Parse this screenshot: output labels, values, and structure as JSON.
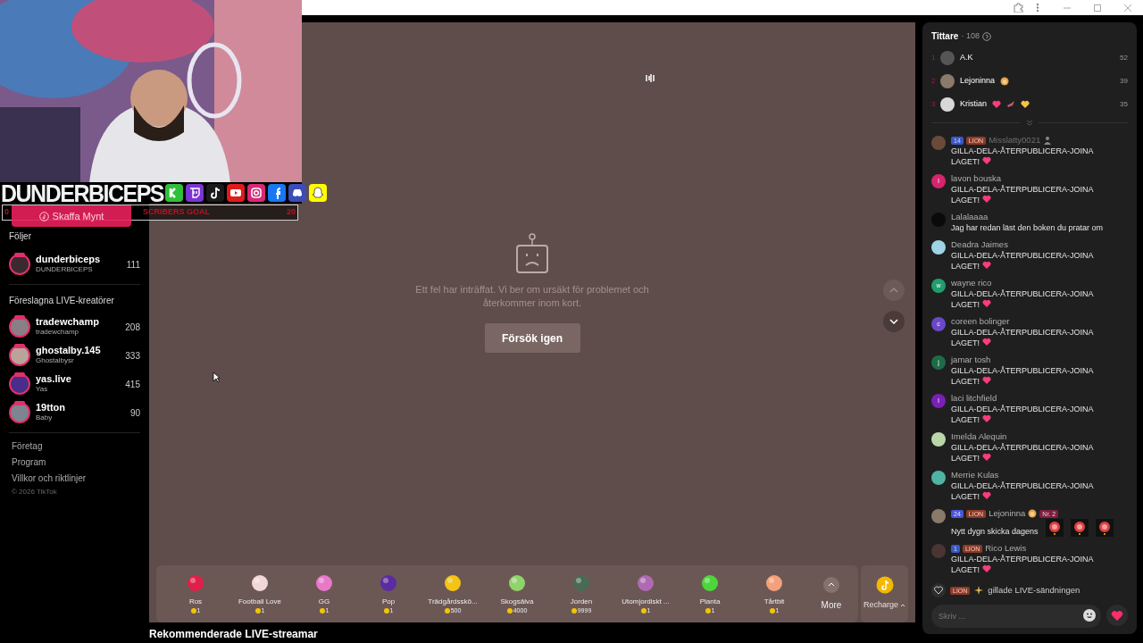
{
  "overlay": {
    "channel_name": "DUNDERBICEPS",
    "socials": [
      {
        "kind": "kick",
        "color": "#2fbf3a"
      },
      {
        "kind": "twitch",
        "color": "#7a34d1"
      },
      {
        "kind": "tiktok",
        "color": "#1a1a1a"
      },
      {
        "kind": "youtube",
        "color": "#e01b1b"
      },
      {
        "kind": "instagram",
        "color": "#d62976"
      },
      {
        "kind": "facebook",
        "color": "#1877f2"
      },
      {
        "kind": "discord",
        "color": "#3b4bb8"
      },
      {
        "kind": "snapchat",
        "color": "#fffc00"
      }
    ],
    "goal": {
      "start": "0",
      "label": "SCRIBERS GOAL",
      "end": "20"
    }
  },
  "coins_button": "Skaffa Mynt",
  "sidebar": {
    "following_title": "Följer",
    "following": [
      {
        "name": "dunderbiceps",
        "subtitle": "DUNDERBICEPS",
        "count": "111",
        "live": true,
        "color": "#3a2a30"
      }
    ],
    "suggested_title": "Föreslagna LIVE-kreatörer",
    "suggested": [
      {
        "name": "tradewchamp",
        "subtitle": "tradewchamp",
        "count": "208",
        "live": true,
        "color": "#8a7f86"
      },
      {
        "name": "ghostalby.145",
        "subtitle": "Ghostalbysr",
        "count": "333",
        "live": true,
        "color": "#b9a49a"
      },
      {
        "name": "yas.live",
        "subtitle": "Yas",
        "count": "415",
        "live": true,
        "color": "#4a2d8a"
      },
      {
        "name": "19tton",
        "subtitle": "Baby",
        "count": "90",
        "live": true,
        "color": "#7d8590"
      }
    ],
    "links": [
      "Företag",
      "Program",
      "Villkor och riktlinjer"
    ],
    "copyright": "© 2026 TikTok"
  },
  "stream": {
    "error_text": "Ett fel har inträffat. Vi ber om ursäkt för problemet och återkommer inom kort.",
    "retry_button": "Försök igen"
  },
  "gifts": [
    {
      "name": "Ros",
      "price": "1",
      "color": "#e0204a"
    },
    {
      "name": "Football Love",
      "price": "1",
      "color": "#f2d7d7"
    },
    {
      "name": "GG",
      "price": "1",
      "color": "#e879c9"
    },
    {
      "name": "Pop",
      "price": "1",
      "color": "#5b2ca0"
    },
    {
      "name": "Trädgårdsskö...",
      "price": "500",
      "color": "#f3c316"
    },
    {
      "name": "Skogsälva",
      "price": "4000",
      "color": "#8fd46a"
    },
    {
      "name": "Jorden",
      "price": "9999",
      "color": "#4b6a55"
    },
    {
      "name": "Utomjordiskt ...",
      "price": "1",
      "color": "#b06ab3"
    },
    {
      "name": "Planta",
      "price": "1",
      "color": "#4cd63a"
    },
    {
      "name": "Tårtbit",
      "price": "1",
      "color": "#f4a07a"
    }
  ],
  "more_button": "More",
  "recharge_button": "Recharge",
  "recommended_title": "Rekommenderade LIVE-streamar",
  "chat": {
    "title": "Tittare",
    "viewer_count": "· 108",
    "top_viewers": [
      {
        "rank": "1",
        "name": "A.K",
        "score": "52",
        "color": "#555555"
      },
      {
        "rank": "2",
        "name": "Lejoninna",
        "score": "39",
        "color": "#8a7a6a",
        "icons": [
          {
            "kind": "lion"
          }
        ]
      },
      {
        "rank": "3",
        "name": "Kristian",
        "score": "35",
        "color": "#d8d8d8",
        "icons": [
          {
            "kind": "heart"
          },
          {
            "kind": "bird"
          },
          {
            "kind": "yellow-heart"
          }
        ]
      }
    ],
    "messages": [
      {
        "kind": "comment",
        "user": "Misslatty0021",
        "user_muted": true,
        "avatar": {
          "color": "#6b4a3a"
        },
        "badges": [
          {
            "kind": "level",
            "label": "14"
          },
          {
            "kind": "fan",
            "label": "LION"
          }
        ],
        "name_icons": [
          {
            "kind": "person"
          }
        ],
        "text": "GILLA-DELA-ÅTERPUBLICERA-JOINA LAGET!",
        "heart": true
      },
      {
        "kind": "comment",
        "user": "lavon bouska",
        "user_muted": false,
        "avatar": {
          "color": "#d6246e",
          "initial": "l"
        },
        "text": "GILLA-DELA-ÅTERPUBLICERA-JOINA LAGET!",
        "heart": true
      },
      {
        "kind": "comment",
        "user": "Lalalaaaa",
        "user_muted": false,
        "avatar": {
          "color": "#0a0a0a"
        },
        "text": "Jag har redan läst den boken du pratar om",
        "heart": false
      },
      {
        "kind": "comment",
        "user": "Deadra Jaimes",
        "user_muted": false,
        "avatar": {
          "color": "#9fd3e6"
        },
        "text": "GILLA-DELA-ÅTERPUBLICERA-JOINA LAGET!",
        "heart": true
      },
      {
        "kind": "comment",
        "user": "wayne rico",
        "user_muted": false,
        "avatar": {
          "color": "#1f9d6e",
          "initial": "w"
        },
        "text": "GILLA-DELA-ÅTERPUBLICERA-JOINA LAGET!",
        "heart": true
      },
      {
        "kind": "comment",
        "user": "coreen bolinger",
        "user_muted": false,
        "avatar": {
          "color": "#6a48c9",
          "initial": "c"
        },
        "text": "GILLA-DELA-ÅTERPUBLICERA-JOINA LAGET!",
        "heart": true
      },
      {
        "kind": "comment",
        "user": "jamar tosh",
        "user_muted": false,
        "avatar": {
          "color": "#1e6b47",
          "initial": "j"
        },
        "text": "GILLA-DELA-ÅTERPUBLICERA-JOINA LAGET!",
        "heart": true
      },
      {
        "kind": "comment",
        "user": "laci litchfield",
        "user_muted": false,
        "avatar": {
          "color": "#7a1fb8",
          "initial": "l"
        },
        "text": "GILLA-DELA-ÅTERPUBLICERA-JOINA LAGET!",
        "heart": true
      },
      {
        "kind": "comment",
        "user": "Imelda Alequin",
        "user_muted": false,
        "avatar": {
          "color": "#b9d6a8"
        },
        "text": "GILLA-DELA-ÅTERPUBLICERA-JOINA LAGET!",
        "heart": true
      },
      {
        "kind": "comment",
        "user": "Merrie Kulas",
        "user_muted": false,
        "avatar": {
          "color": "#4fb3a3"
        },
        "text": "GILLA-DELA-ÅTERPUBLICERA-JOINA LAGET!",
        "heart": true
      },
      {
        "kind": "comment",
        "user": "Lejoninna",
        "user_muted": false,
        "avatar": {
          "color": "#8a7a6a"
        },
        "badges": [
          {
            "kind": "gem",
            "label": "24"
          },
          {
            "kind": "fan",
            "label": "LION"
          }
        ],
        "name_icons": [
          {
            "kind": "lion"
          }
        ],
        "badges_after": [
          {
            "kind": "rank",
            "label": "Nr. 2"
          }
        ],
        "text": "Nytt dygn skicka dagens",
        "heart": false,
        "stickers": [
          {
            "kind": "picture"
          },
          {
            "kind": "picture"
          },
          {
            "kind": "picture"
          }
        ]
      },
      {
        "kind": "comment",
        "user": "Rico Lewis",
        "user_muted": false,
        "avatar": {
          "color": "#4a3434"
        },
        "badges": [
          {
            "kind": "level",
            "label": "1"
          },
          {
            "kind": "fan",
            "label": "LION"
          }
        ],
        "text": "GILLA-DELA-ÅTERPUBLICERA-JOINA LAGET!",
        "heart": true
      },
      {
        "kind": "like",
        "badges": [
          {
            "kind": "fan",
            "label": "LION"
          }
        ],
        "text": "gillade LIVE-sändningen"
      }
    ],
    "input_placeholder": "Skriv ..."
  }
}
